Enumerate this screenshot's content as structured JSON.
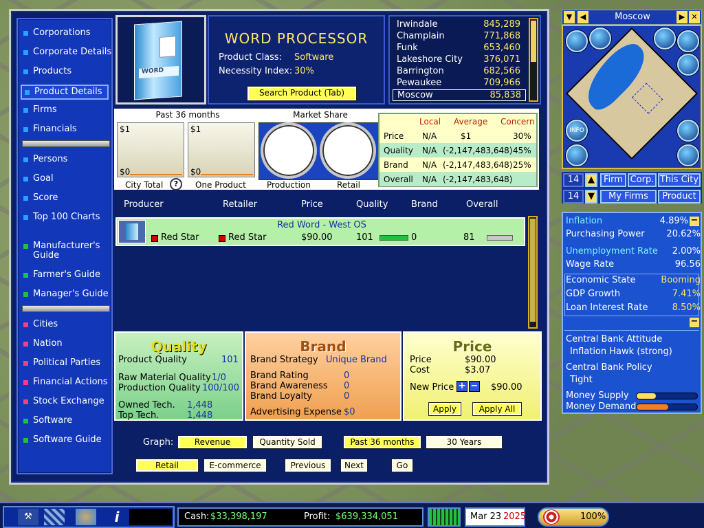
{
  "nav": {
    "items": [
      {
        "label": "Corporations",
        "color": "#2aa0ff"
      },
      {
        "label": "Corporate Details",
        "color": "#2aa0ff"
      },
      {
        "label": "Products",
        "color": "#2aa0ff"
      },
      {
        "label": "Product Details",
        "color": "#2aa0ff"
      },
      {
        "label": "Firms",
        "color": "#2aa0ff"
      },
      {
        "label": "Financials",
        "color": "#2aa0ff"
      },
      {
        "label": "Persons",
        "color": "#2aa0ff"
      },
      {
        "label": "Goal",
        "color": "#2aa0ff"
      },
      {
        "label": "Score",
        "color": "#2aa0ff"
      },
      {
        "label": "Top 100 Charts",
        "color": "#2aa0ff"
      },
      {
        "label": "Manufacturer's Guide",
        "color": "#22c040"
      },
      {
        "label": "Farmer's Guide",
        "color": "#22c040"
      },
      {
        "label": "Manager's Guide",
        "color": "#22c040"
      },
      {
        "label": "Cities",
        "color": "#ff3a8a"
      },
      {
        "label": "Nation",
        "color": "#ff3a8a"
      },
      {
        "label": "Political Parties",
        "color": "#ff3a8a"
      },
      {
        "label": "Financial Actions",
        "color": "#ff3a8a"
      },
      {
        "label": "Stock Exchange",
        "color": "#ff3a8a"
      },
      {
        "label": "Software",
        "color": "#22c040"
      },
      {
        "label": "Software Guide",
        "color": "#22c040"
      }
    ]
  },
  "product": {
    "box_label": "WORD",
    "title": "WORD PROCESSOR",
    "class_label": "Product Class:",
    "class_value": "Software",
    "necessity_label": "Necessity Index:",
    "necessity_value": "30%",
    "search_button": "Search Product (Tab)"
  },
  "cities": [
    {
      "name": "Irwindale",
      "value": "845,289"
    },
    {
      "name": "Champlain",
      "value": "771,868"
    },
    {
      "name": "Funk",
      "value": "653,460"
    },
    {
      "name": "Lakeshore City",
      "value": "376,071"
    },
    {
      "name": "Barrington",
      "value": "682,566"
    },
    {
      "name": "Pewaukee",
      "value": "709,966"
    },
    {
      "name": "Moscow",
      "value": "85,838"
    }
  ],
  "charts": {
    "past_label": "Past 36 months",
    "market_share_label": "Market Share",
    "city_total": {
      "top": "$1",
      "bottom": "$0",
      "caption": "City Total"
    },
    "one_product": {
      "top": "$1",
      "bottom": "$0",
      "caption": "One Product"
    },
    "help_icon": "?",
    "pie_production": "Production",
    "pie_retail": "Retail"
  },
  "concern_table": {
    "headers": [
      "Local",
      "Average",
      "Concern"
    ],
    "rows": [
      {
        "label": "Price",
        "local": "N/A",
        "average": "$1",
        "concern": "30%"
      },
      {
        "label": "Quality",
        "local": "N/A",
        "average": "(-2,147,483,648)",
        "concern": "45%"
      },
      {
        "label": "Brand",
        "local": "N/A",
        "average": "(-2,147,483,648)",
        "concern": "25%"
      },
      {
        "label": "Overall",
        "local": "N/A",
        "average": "(-2,147,483,648)",
        "concern": ""
      }
    ]
  },
  "list": {
    "headers": [
      "Producer",
      "Retailer",
      "Price",
      "Quality",
      "Brand",
      "Overall"
    ],
    "row": {
      "title": "Red Word - West OS",
      "producer": "Red Star",
      "retailer": "Red Star",
      "price": "$90.00",
      "quality": "101",
      "brand": "0",
      "overall": "81"
    }
  },
  "quality": {
    "title": "Quality",
    "product_quality_label": "Product Quality",
    "product_quality": "101",
    "raw_label": "Raw Material Quality",
    "raw": "1/0",
    "prod_label": "Production Quality",
    "prod": "100/100",
    "owned_label": "Owned Tech.",
    "owned": "1,448",
    "top_label": "Top Tech.",
    "top": "1,448"
  },
  "brand": {
    "title": "Brand",
    "strategy_label": "Brand Strategy",
    "strategy": "Unique Brand",
    "rating_label": "Brand Rating",
    "rating": "0",
    "awareness_label": "Brand Awareness",
    "awareness": "0",
    "loyalty_label": "Brand Loyalty",
    "loyalty": "0",
    "adv_label": "Advertising Expense",
    "adv": "$0"
  },
  "price": {
    "title": "Price",
    "price_label": "Price",
    "price": "$90.00",
    "cost_label": "Cost",
    "cost": "$3.07",
    "new_label": "New Price",
    "new": "$90.00",
    "apply": "Apply",
    "apply_all": "Apply All"
  },
  "graph": {
    "label": "Graph:",
    "revenue": "Revenue",
    "qty": "Quantity Sold",
    "past": "Past 36 months",
    "years": "30 Years",
    "retail": "Retail",
    "ecommerce": "E-commerce",
    "previous": "Previous",
    "next": "Next",
    "go": "Go"
  },
  "minimap": {
    "city": "Moscow",
    "info": "INFO"
  },
  "rbuttons": {
    "num1": "14",
    "num2": "14",
    "firm": "Firm",
    "corp": "Corp.",
    "this_city": "This City",
    "my_firms": "My Firms",
    "product": "Product"
  },
  "econ": {
    "inflation_label": "Inflation",
    "inflation": "4.89%",
    "purchasing_label": "Purchasing Power",
    "purchasing": "20.62%",
    "unemp_label": "Unemployment Rate",
    "unemp": "2.00%",
    "wage_label": "Wage Rate",
    "wage": "96.56",
    "state_label": "Economic State",
    "state": "Booming",
    "gdp_label": "GDP Growth",
    "gdp": "7.41%",
    "loan_label": "Loan Interest Rate",
    "loan": "8.50%",
    "attitude_label": "Central Bank Attitude",
    "attitude": "Inflation Hawk (strong)",
    "policy_label": "Central Bank Policy",
    "policy": "Tight",
    "money_supply": "Money Supply",
    "money_demand": "Money Demand"
  },
  "status": {
    "cash_label": "Cash:",
    "cash": "$33,398,197",
    "profit_label": "Profit:",
    "profit": "$639,334,051",
    "month": "Mar 23",
    "year": "2025",
    "speed": "100%"
  }
}
